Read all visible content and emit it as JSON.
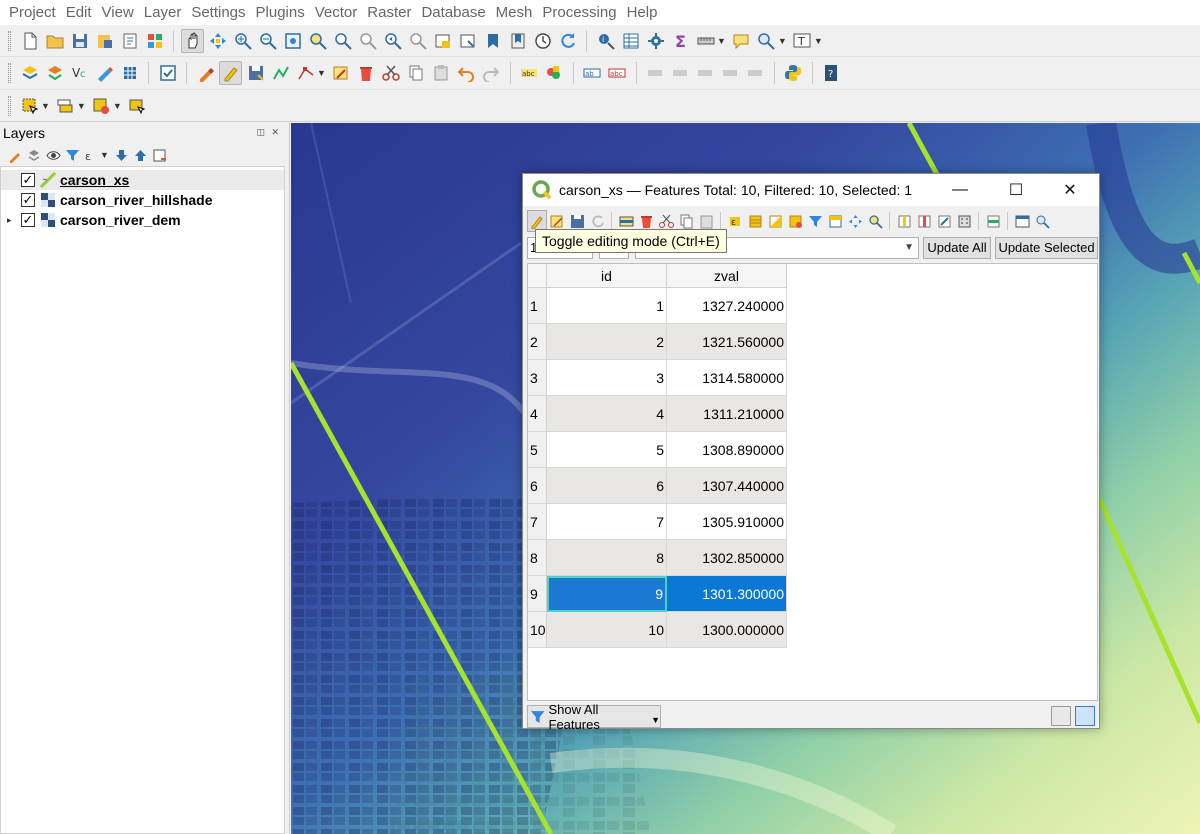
{
  "menu": [
    "Project",
    "Edit",
    "View",
    "Layer",
    "Settings",
    "Plugins",
    "Vector",
    "Raster",
    "Database",
    "Mesh",
    "Processing",
    "Help"
  ],
  "layers_panel": {
    "title": "Layers",
    "layers": [
      {
        "name": "carson_xs",
        "checked": "✓",
        "type": "vector-line",
        "active": true
      },
      {
        "name": "carson_river_hillshade",
        "checked": "✓",
        "type": "raster"
      },
      {
        "name": "carson_river_dem",
        "checked": "✓",
        "type": "raster",
        "expander": "▸"
      }
    ]
  },
  "attribute_table": {
    "title": "carson_xs — Features Total: 10, Filtered: 10, Selected: 1",
    "window_buttons": {
      "minimize": "—",
      "maximize": "☐",
      "close": "✕"
    },
    "tooltip": "Toggle editing mode (Ctrl+E)",
    "field_combo_value": "1",
    "update_all_label": "Update All",
    "update_selected_label": "Update Selected",
    "columns": [
      "id",
      "zval"
    ],
    "rows": [
      {
        "row": "1",
        "id": "1",
        "zval": "1327.240000"
      },
      {
        "row": "2",
        "id": "2",
        "zval": "1321.560000"
      },
      {
        "row": "3",
        "id": "3",
        "zval": "1314.580000"
      },
      {
        "row": "4",
        "id": "4",
        "zval": "1311.210000"
      },
      {
        "row": "5",
        "id": "5",
        "zval": "1308.890000"
      },
      {
        "row": "6",
        "id": "6",
        "zval": "1307.440000"
      },
      {
        "row": "7",
        "id": "7",
        "zval": "1305.910000"
      },
      {
        "row": "8",
        "id": "8",
        "zval": "1302.850000"
      },
      {
        "row": "9",
        "id": "9",
        "zval": "1301.300000",
        "selected": true
      },
      {
        "row": "10",
        "id": "10",
        "zval": "1300.000000"
      }
    ],
    "filter_button_label": "Show All Features"
  },
  "colors": {
    "selection": "#0a78d4",
    "current_cell_border": "#4fd0c5",
    "cross_section_line": "#a6e22e",
    "dem_low": "#2f3f9a",
    "dem_high": "#e8f0a8"
  }
}
